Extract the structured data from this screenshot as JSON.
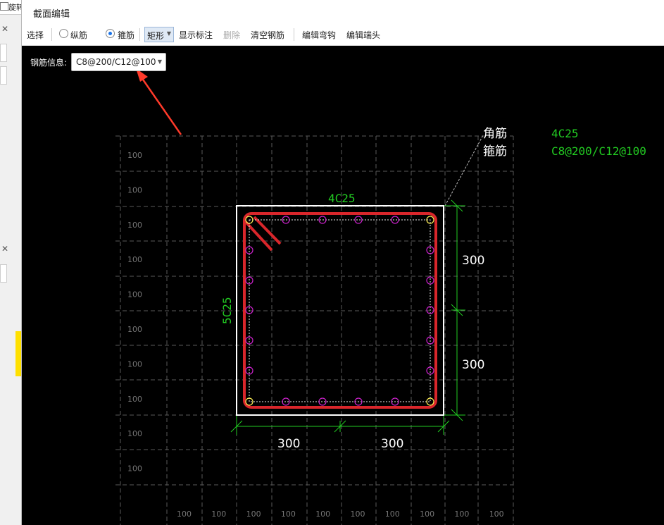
{
  "left_panel": {
    "checkbox_label": "旋转"
  },
  "window": {
    "title": "截面编辑"
  },
  "toolbar": {
    "select": "选择",
    "longitudinal": "纵筋",
    "stirrup": "箍筋",
    "shape": "矩形",
    "show_dims": "显示标注",
    "delete": "删除",
    "clear": "清空钢筋",
    "edit_hook": "编辑弯钩",
    "edit_end": "编辑端头"
  },
  "rebar_info": {
    "label": "钢筋信息:",
    "value": "C8@200/C12@100"
  },
  "drawing": {
    "top_rebar": "4C25",
    "side_rebar": "5C25",
    "legend": [
      {
        "name": "角筋",
        "value": "4C25"
      },
      {
        "name": "箍筋",
        "value": "C8@200/C12@100"
      }
    ],
    "dim_right": [
      "300",
      "300"
    ],
    "dim_bottom": [
      "300",
      "300"
    ],
    "grid_left_labels": [
      "100",
      "100",
      "100",
      "100",
      "100",
      "100",
      "100",
      "100",
      "100",
      "100"
    ],
    "grid_bottom_labels": [
      "100",
      "100",
      "100",
      "100",
      "100",
      "100",
      "100",
      "100",
      "100",
      "100"
    ]
  },
  "colors": {
    "canvas": "#000000",
    "grid": "#5a5a5a",
    "stirrup": "#d9262b",
    "dim": "#22cc22",
    "bar_corner": "#ffee55",
    "bar_side": "#cc22cc",
    "arrow": "#ff3a2a"
  }
}
